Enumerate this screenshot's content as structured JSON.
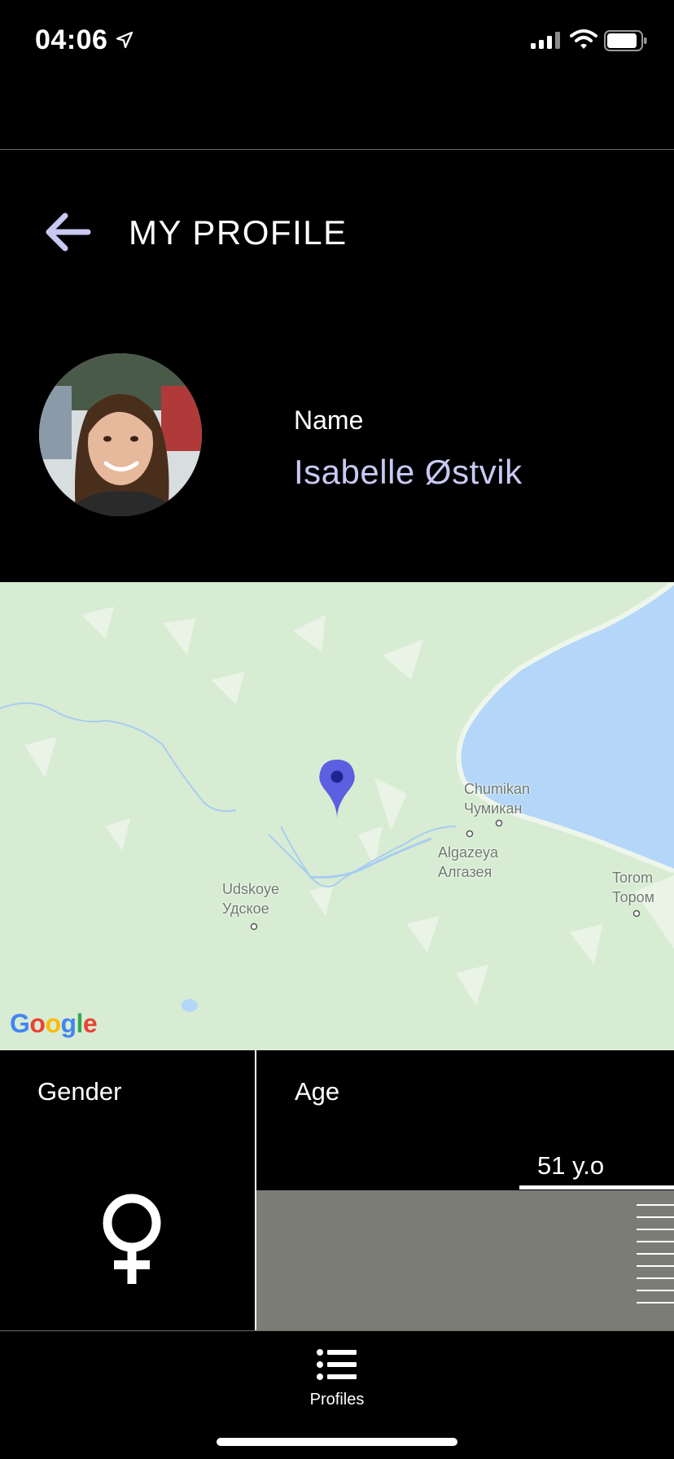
{
  "status_bar": {
    "time": "04:06",
    "icons": [
      "location-arrow-icon",
      "cellular-signal-icon",
      "wifi-icon",
      "battery-icon"
    ]
  },
  "header": {
    "back_icon": "arrow-left-icon",
    "title": "MY PROFILE",
    "back_color": "#c9c8f2"
  },
  "profile": {
    "name_label": "Name",
    "name_value": "Isabelle Østvik",
    "name_color": "#c9c8f2"
  },
  "map": {
    "places": [
      {
        "latin": "Chumikan",
        "cyrillic": "Чумикан"
      },
      {
        "latin": "Algazeya",
        "cyrillic": "Алгазея"
      },
      {
        "latin": "Torom",
        "cyrillic": "Тором"
      },
      {
        "latin": "Udskoye",
        "cyrillic": "Удское"
      }
    ],
    "logo": "Google",
    "pin_color": "#5b5fe0",
    "water_color": "#b4d6f8",
    "land_color": "#d8ecd3"
  },
  "gender": {
    "label": "Gender",
    "icon": "female-symbol-icon"
  },
  "age": {
    "label": "Age",
    "value_text": "51 y.o"
  },
  "tab_bar": {
    "profiles_label": "Profiles",
    "profiles_icon": "list-icon"
  }
}
